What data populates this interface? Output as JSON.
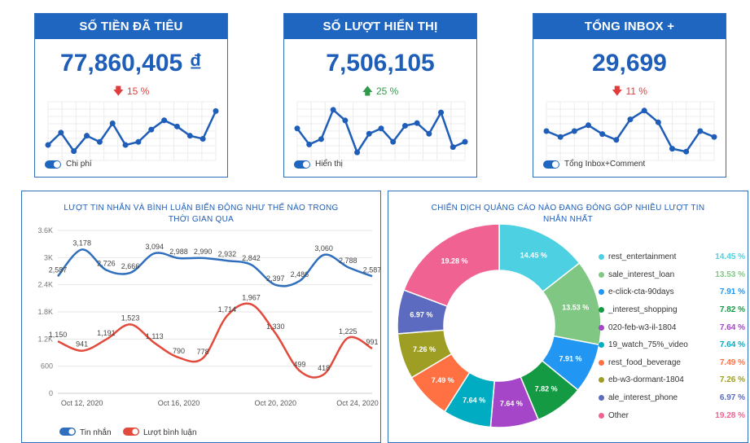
{
  "kpis": [
    {
      "title": "SỐ TIỀN ĐÃ TIÊU",
      "value": "77,860,405 ₫",
      "delta": "15 %",
      "direction": "down",
      "toggle_label": "Chi phí",
      "trend": [
        12,
        16,
        10,
        15,
        13,
        19,
        12,
        13,
        17,
        20,
        18,
        15,
        14,
        23
      ]
    },
    {
      "title": "SỐ LƯỢT HIỂN THỊ",
      "value": "7,506,105",
      "delta": "25 %",
      "direction": "up",
      "toggle_label": "Hiển thị",
      "trend": [
        16,
        10,
        12,
        23,
        19,
        7,
        14,
        16,
        11,
        17,
        18,
        14,
        22,
        9,
        11
      ]
    },
    {
      "title": "TỔNG INBOX +",
      "value": "29,699",
      "delta": "11 %",
      "direction": "down",
      "toggle_label": "Tổng Inbox+Comment",
      "trend": [
        14,
        12,
        14,
        16,
        13,
        11,
        18,
        21,
        17,
        8,
        7,
        14,
        12
      ]
    }
  ],
  "colors": {
    "header": "#1f66c0",
    "value": "#1f5eb8",
    "down": "#e03c3c",
    "up": "#2e9a4a",
    "line_blue": "#2f6fbe",
    "line_red": "#e24a3b"
  },
  "line_panel": {
    "title": "LƯỢT TIN NHẮN VÀ BÌNH LUẬN BIẾN ĐỘNG NHƯ THẾ NÀO TRONG THỜI GIAN QUA",
    "legend": [
      "Tin nhắn",
      "Lượt bình luận"
    ]
  },
  "pie_panel": {
    "title": "CHIẾN DỊCH QUẢNG CÁO NÀO ĐANG ĐÓNG GÓP NHIỀU LƯỢT TIN NHẮN NHẤT"
  },
  "chart_data": [
    {
      "type": "line",
      "title": "LƯỢT TIN NHẮN VÀ BÌNH LUẬN BIẾN ĐỘNG NHƯ THẾ NÀO TRONG THỜI GIAN QUA",
      "x_tick_labels": [
        "Oct 12, 2020",
        "Oct 16, 2020",
        "Oct 20, 2020",
        "Oct 24, 2020"
      ],
      "y_ticks": [
        "0",
        "600",
        "1.2K",
        "1.8K",
        "2.4K",
        "3K",
        "3.6K"
      ],
      "ylim": [
        0,
        3600
      ],
      "grid": true,
      "legend_position": "bottom-left",
      "series": [
        {
          "name": "Tin nhắn",
          "color": "#2f6fbe",
          "values": [
            2587,
            3178,
            2726,
            2666,
            3094,
            2988,
            2990,
            2932,
            2842,
            2397,
            2486,
            3060,
            2788,
            2587
          ],
          "labels": [
            "2,587",
            "3,178",
            "2,726",
            "2,666",
            "3,094",
            "2,988",
            "2,990",
            "2,932",
            "2,842",
            "2,397",
            "2,486",
            "3,060",
            "2,788",
            "2,587"
          ]
        },
        {
          "name": "Lượt bình luận",
          "color": "#e24a3b",
          "values": [
            1150,
            941,
            1191,
            1523,
            1113,
            790,
            778,
            1714,
            1967,
            1330,
            499,
            418,
            1225,
            991
          ],
          "labels": [
            "1,150",
            "941",
            "1,191",
            "1,523",
            "1,113",
            "790",
            "778",
            "1,714",
            "1,967",
            "1,330",
            "499",
            "418",
            "1,225",
            "991"
          ]
        }
      ]
    },
    {
      "type": "pie",
      "title": "CHIẾN DỊCH QUẢNG CÁO NÀO ĐANG ĐÓNG GÓP NHIỀU LƯỢT TIN NHẮN NHẤT",
      "legend_position": "right",
      "slices": [
        {
          "label": "rest_entertainment",
          "value": 14.45,
          "pct": "14.45 %",
          "color": "#4dd0e1"
        },
        {
          "label": "sale_interest_loan",
          "value": 13.53,
          "pct": "13.53 %",
          "color": "#81c784"
        },
        {
          "label": "e-click-cta-90days",
          "value": 7.91,
          "pct": "7.91 %",
          "color": "#2196f3"
        },
        {
          "label": "_interest_shopping",
          "value": 7.82,
          "pct": "7.82 %",
          "color": "#139a43"
        },
        {
          "label": "020-feb-w3-il-1804",
          "value": 7.64,
          "pct": "7.64 %",
          "color": "#a545c8"
        },
        {
          "label": "19_watch_75%_video",
          "value": 7.64,
          "pct": "7.64 %",
          "color": "#00acc1"
        },
        {
          "label": "rest_food_beverage",
          "value": 7.49,
          "pct": "7.49 %",
          "color": "#ff7043"
        },
        {
          "label": "eb-w3-dormant-1804",
          "value": 7.26,
          "pct": "7.26 %",
          "color": "#9e9d24"
        },
        {
          "label": "ale_interest_phone",
          "value": 6.97,
          "pct": "6.97 %",
          "color": "#5c6bc0"
        },
        {
          "label": "Other",
          "value": 19.28,
          "pct": "19.28 %",
          "color": "#f06292"
        }
      ]
    }
  ]
}
